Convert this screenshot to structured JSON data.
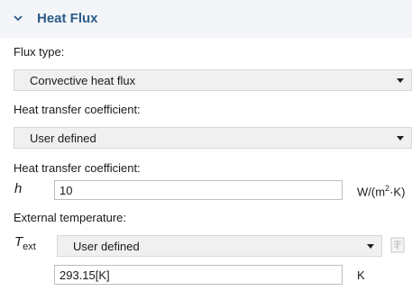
{
  "section": {
    "title": "Heat Flux",
    "icon": "chevron-down-icon"
  },
  "flux_type": {
    "label": "Flux type:",
    "value": "Convective heat flux"
  },
  "htc_method": {
    "label": "Heat transfer coefficient:",
    "value": "User defined"
  },
  "htc_value": {
    "label": "Heat transfer coefficient:",
    "symbol": "h",
    "value": "10",
    "unit_main": "W/(m",
    "unit_sup": "2",
    "unit_end": "·K)"
  },
  "ext_temp": {
    "label": "External temperature:",
    "symbol": "T",
    "symbol_sub": "ext",
    "select_value": "User defined",
    "value": "293.15[K]",
    "unit": "K",
    "side_icon": "variable-link-icon"
  },
  "colors": {
    "header_bg": "#f3f5f8",
    "title": "#2c5c88",
    "select_bg": "#f0f0f0"
  }
}
